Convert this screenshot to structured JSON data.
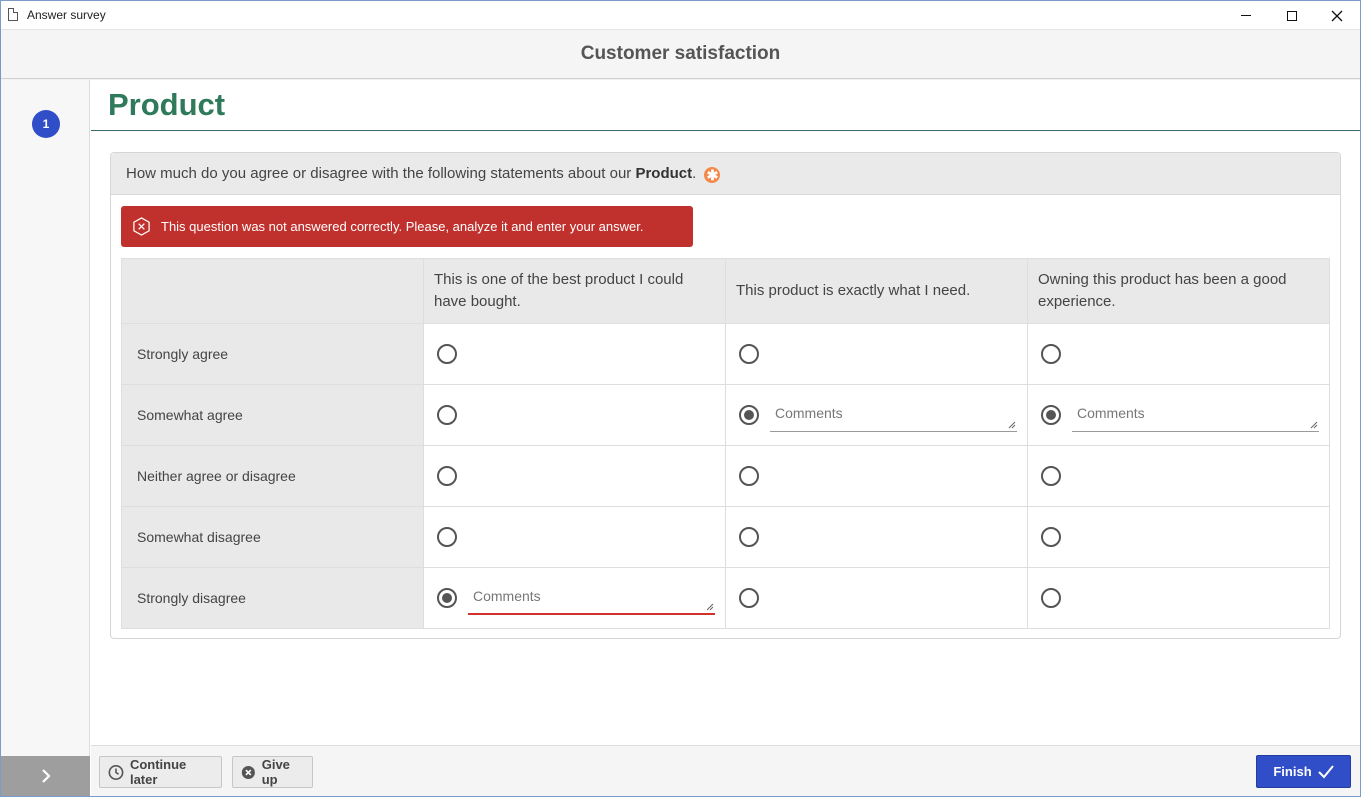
{
  "window": {
    "title": "Answer survey",
    "icon": "document-icon"
  },
  "header": {
    "survey_title": "Customer satisfaction"
  },
  "sidebar": {
    "steps": [
      {
        "number": "1",
        "active": true
      }
    ],
    "expand_icon": "chevron-right-icon"
  },
  "page": {
    "title": "Product",
    "title_color": "#2e7a5b"
  },
  "question": {
    "text_prefix": "How much do you agree or disagree with the following statements about our",
    "text_bold": "Product",
    "text_suffix": ".",
    "required_icon": "asterisk-icon",
    "error_message": "This question was not answered correctly. Please, analyze it and enter your answer.",
    "error_color": "#c0302c",
    "columns": [
      "This is one of the best product I could have bought.",
      "This product is exactly what I need.",
      "Owning this product has been a good experience."
    ],
    "rows": [
      {
        "label": "Strongly agree",
        "cells": [
          {
            "checked": false
          },
          {
            "checked": false
          },
          {
            "checked": false
          }
        ]
      },
      {
        "label": "Somewhat agree",
        "cells": [
          {
            "checked": false
          },
          {
            "checked": true,
            "comment_placeholder": "Comments",
            "comment_value": ""
          },
          {
            "checked": true,
            "comment_placeholder": "Comments",
            "comment_value": ""
          }
        ]
      },
      {
        "label": "Neither agree or disagree",
        "cells": [
          {
            "checked": false
          },
          {
            "checked": false
          },
          {
            "checked": false
          }
        ]
      },
      {
        "label": "Somewhat disagree",
        "cells": [
          {
            "checked": false
          },
          {
            "checked": false
          },
          {
            "checked": false
          }
        ]
      },
      {
        "label": "Strongly disagree",
        "cells": [
          {
            "checked": true,
            "comment_placeholder": "Comments",
            "comment_value": "",
            "invalid": true
          },
          {
            "checked": false
          },
          {
            "checked": false
          }
        ]
      }
    ]
  },
  "footer": {
    "continue_later_label": "Continue later",
    "continue_later_icon": "clock-icon",
    "give_up_label": "Give up",
    "give_up_icon": "close-circle-icon",
    "finish_label": "Finish",
    "finish_icon": "checkmark-icon",
    "accent": "#2f4ec7"
  }
}
